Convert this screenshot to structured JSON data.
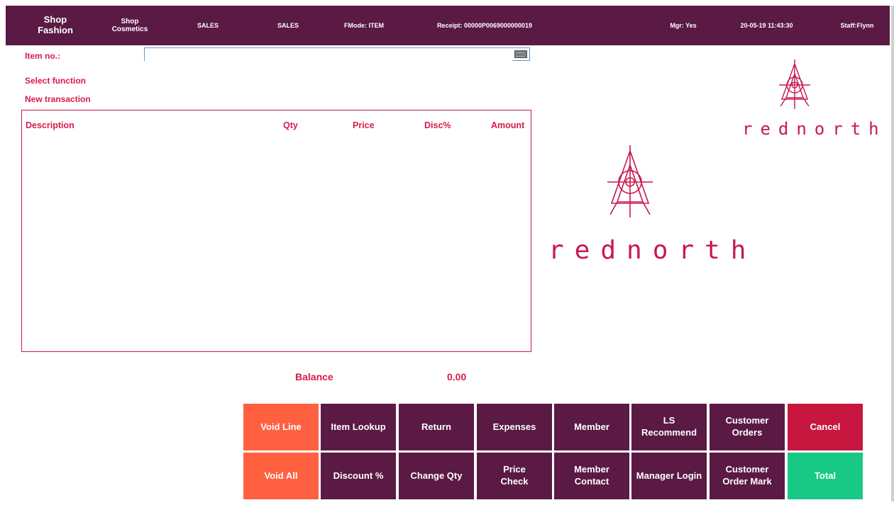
{
  "header": {
    "shop_primary": "Shop\nFashion",
    "shop_secondary": "Shop\nCosmetics",
    "mode1": "SALES",
    "mode2": "SALES",
    "fmode": "FMode: ITEM",
    "receipt": "Receipt: 00000P0069000000019",
    "manager": "Mgr: Yes",
    "datetime": "20-05-19 11:43:30",
    "staff": "Staff:Flynn"
  },
  "labels": {
    "item_no": "Item no.:",
    "select_function": "Select function",
    "new_transaction": "New transaction"
  },
  "item_input": {
    "value": "",
    "placeholder": ""
  },
  "grid": {
    "columns": [
      "Description",
      "Qty",
      "Price",
      "Disc%",
      "Amount"
    ],
    "rows": []
  },
  "branding": {
    "small": "rednorth",
    "large": "rednorth",
    "color": "#c8194f"
  },
  "balance": {
    "label": "Balance",
    "value": "0.00"
  },
  "buttons": {
    "void_line": "Void Line",
    "item_lookup": "Item Lookup",
    "return": "Return",
    "expenses": "Expenses",
    "member": "Member",
    "ls_recommend": "LS Recommend",
    "customer_orders": "Customer\nOrders",
    "cancel": "Cancel",
    "void_all": "Void All",
    "discount": "Discount %",
    "change_qty": "Change Qty",
    "price_check": "Price\nCheck",
    "member_contact": "Member\nContact",
    "manager_login": "Manager Login",
    "customer_order_mark": "Customer\nOrder Mark",
    "total": "Total"
  },
  "colors": {
    "header_bg": "#5a1a44",
    "accent": "#d81b4a",
    "void_btn": "#ff6040",
    "cancel_btn": "#c8173f",
    "total_btn": "#17c985"
  }
}
